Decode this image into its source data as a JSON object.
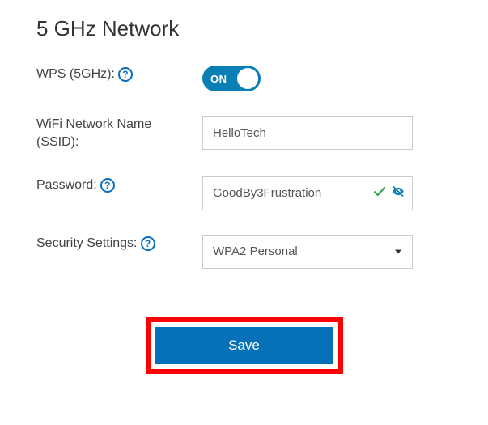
{
  "title": "5 GHz Network",
  "wps": {
    "label": "WPS (5GHz):",
    "state_text": "ON",
    "enabled": true
  },
  "ssid": {
    "label_line1": "WiFi Network Name",
    "label_line2": "(SSID):",
    "value": "HelloTech"
  },
  "password": {
    "label": "Password:",
    "value": "GoodBy3Frustration"
  },
  "security": {
    "label": "Security Settings:",
    "selected": "WPA2 Personal"
  },
  "actions": {
    "save": "Save"
  },
  "help_glyph": "?"
}
